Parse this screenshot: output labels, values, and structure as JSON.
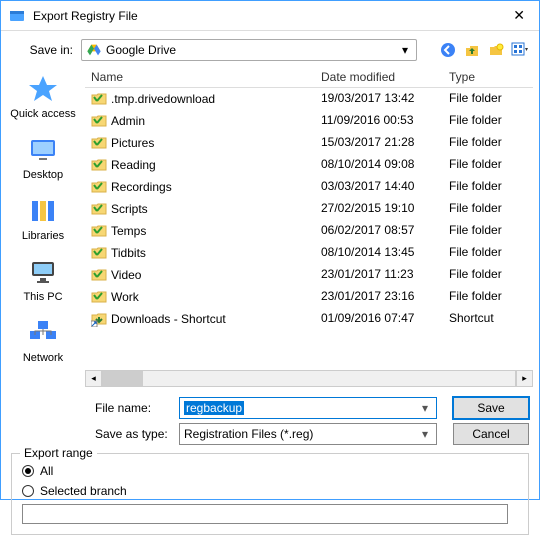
{
  "title": "Export Registry File",
  "savein_label": "Save in:",
  "location": {
    "name": "Google Drive"
  },
  "places": [
    {
      "label": "Quick access"
    },
    {
      "label": "Desktop"
    },
    {
      "label": "Libraries"
    },
    {
      "label": "This PC"
    },
    {
      "label": "Network"
    }
  ],
  "columns": {
    "name": "Name",
    "date": "Date modified",
    "type": "Type"
  },
  "rows": [
    {
      "name": ".tmp.drivedownload",
      "date": "19/03/2017 13:42",
      "type": "File folder",
      "icon": "folder"
    },
    {
      "name": "Admin",
      "date": "11/09/2016 00:53",
      "type": "File folder",
      "icon": "folder"
    },
    {
      "name": "Pictures",
      "date": "15/03/2017 21:28",
      "type": "File folder",
      "icon": "folder"
    },
    {
      "name": "Reading",
      "date": "08/10/2014 09:08",
      "type": "File folder",
      "icon": "folder"
    },
    {
      "name": "Recordings",
      "date": "03/03/2017 14:40",
      "type": "File folder",
      "icon": "folder"
    },
    {
      "name": "Scripts",
      "date": "27/02/2015 19:10",
      "type": "File folder",
      "icon": "folder"
    },
    {
      "name": "Temps",
      "date": "06/02/2017 08:57",
      "type": "File folder",
      "icon": "folder"
    },
    {
      "name": "Tidbits",
      "date": "08/10/2014 13:45",
      "type": "File folder",
      "icon": "folder"
    },
    {
      "name": "Video",
      "date": "23/01/2017 11:23",
      "type": "File folder",
      "icon": "folder"
    },
    {
      "name": "Work",
      "date": "23/01/2017 23:16",
      "type": "File folder",
      "icon": "folder"
    },
    {
      "name": "Downloads - Shortcut",
      "date": "01/09/2016 07:47",
      "type": "Shortcut",
      "icon": "shortcut"
    }
  ],
  "filename_label": "File name:",
  "filename_value": "regbackup",
  "saveas_label": "Save as type:",
  "saveas_value": "Registration Files (*.reg)",
  "save_btn": "Save",
  "cancel_btn": "Cancel",
  "export_range": {
    "legend": "Export range",
    "all": "All",
    "selected": "Selected branch",
    "branch_value": ""
  }
}
